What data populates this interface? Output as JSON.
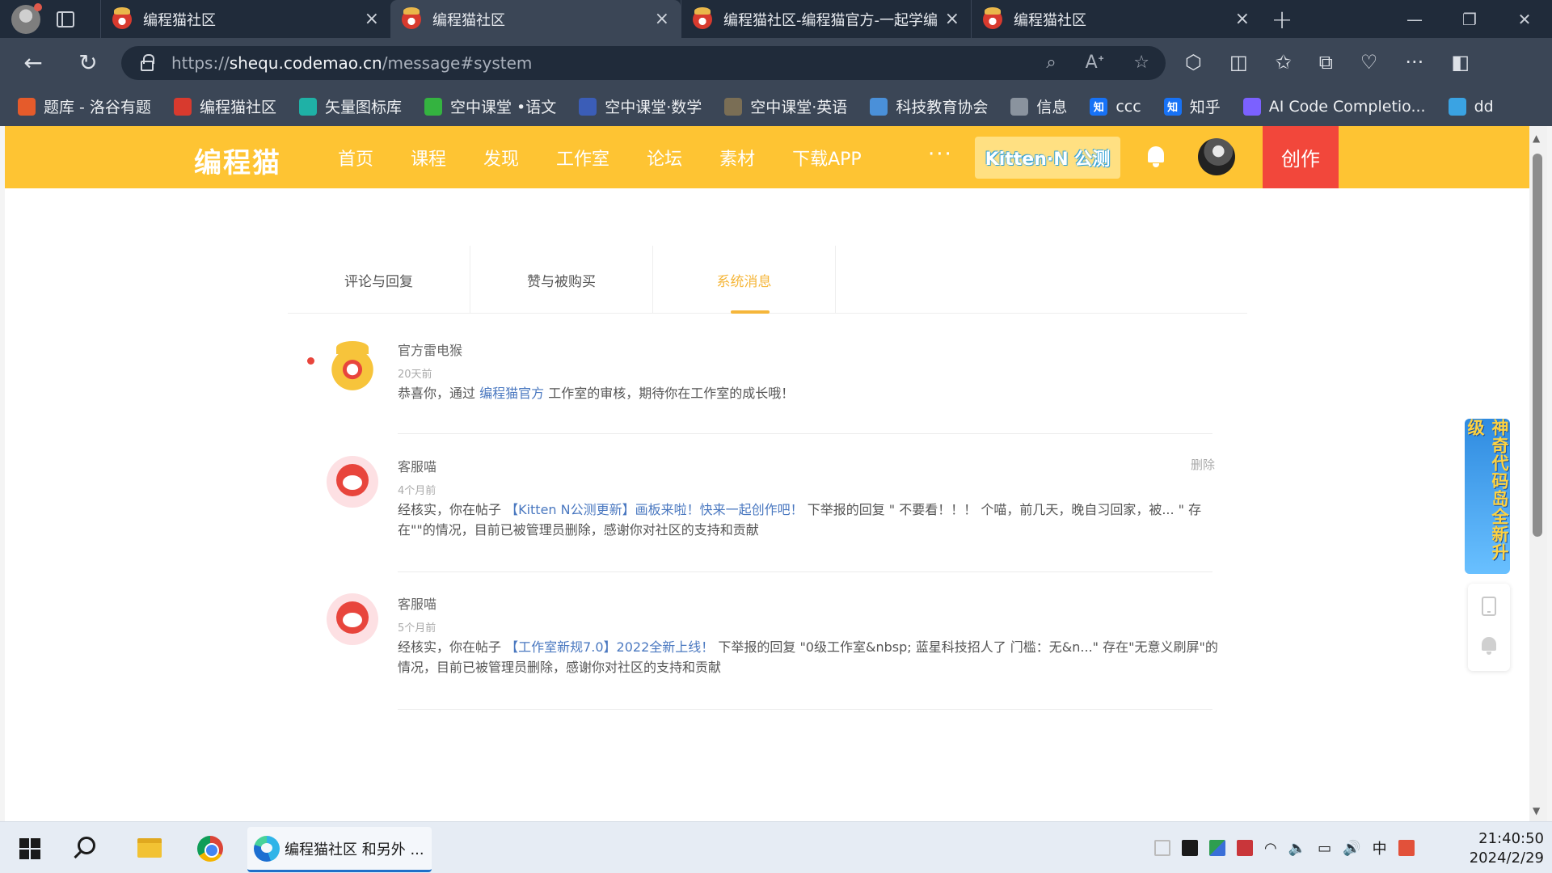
{
  "browser": {
    "tabs": [
      {
        "title": "编程猫社区",
        "active": false
      },
      {
        "title": "编程猫社区",
        "active": true
      },
      {
        "title": "编程猫社区-编程猫官方-一起学编",
        "active": false
      },
      {
        "title": "编程猫社区",
        "active": false
      }
    ],
    "url_prefix": "https://",
    "url_host": "shequ.codemao.cn",
    "url_path": "/message#system",
    "bookmarks": [
      {
        "label": "题库 - 洛谷有题",
        "color": "#e55b2b"
      },
      {
        "label": "编程猫社区",
        "color": "#d83a2e"
      },
      {
        "label": "矢量图标库",
        "color": "#1fb1a6"
      },
      {
        "label": "空中课堂 •语文",
        "color": "#34b340"
      },
      {
        "label": "空中课堂·数学",
        "color": "#3b5db7"
      },
      {
        "label": "空中课堂·英语",
        "color": "#7a6e55"
      },
      {
        "label": "科技教育协会",
        "color": "#4a90d9"
      },
      {
        "label": "信息",
        "color": "#8a939e"
      },
      {
        "label": "ccc",
        "color": "#1772f6",
        "glyph": "知"
      },
      {
        "label": "知乎",
        "color": "#1772f6",
        "glyph": "知"
      },
      {
        "label": "AI Code Completio...",
        "color": "#7b61ff"
      },
      {
        "label": "dd",
        "color": "#3aa3e3"
      }
    ]
  },
  "site": {
    "logo": "编程猫",
    "nav": [
      "首页",
      "课程",
      "发现",
      "工作室",
      "论坛",
      "素材",
      "下载APP"
    ],
    "more": "···",
    "kitten_badge": "Kitten·N 公测",
    "create_label": "创作",
    "brand_color": "#fec433",
    "accent_color": "#f5b63a"
  },
  "messages_page": {
    "tabs": [
      {
        "label": "评论与回复",
        "active": false
      },
      {
        "label": "赞与被购买",
        "active": false
      },
      {
        "label": "系统消息",
        "active": true
      }
    ],
    "items": [
      {
        "unread": true,
        "avatar": "tiger-avatar",
        "name": "官方雷电猴",
        "time": "20天前",
        "body_before": "恭喜你，通过 ",
        "body_link": "编程猫官方",
        "body_after": " 工作室的审核，期待你在工作室的成长哦！",
        "delete_label": ""
      },
      {
        "unread": false,
        "avatar": "cat-avatar",
        "name": "客服喵",
        "time": "4个月前",
        "body_before": "经核实，你在帖子 ",
        "body_link": "【Kitten N公测更新】画板来啦！快来一起创作吧！",
        "body_after": " 下举报的回复 \" 不要看！！！ 个喵，前几天，晚自习回家，被... \" 存在\"\"的情况，目前已被管理员删除，感谢你对社区的支持和贡献",
        "delete_label": "删除"
      },
      {
        "unread": false,
        "avatar": "cat-avatar",
        "name": "客服喵",
        "time": "5个月前",
        "body_before": "经核实，你在帖子 ",
        "body_link": "【工作室新规7.0】2022全新上线！",
        "body_after": " 下举报的回复 \"0级工作室&nbsp; 蓝星科技招人了 门槛：无&n...\" 存在\"无意义刷屏\"的情况，目前已被管理员删除，感谢你对社区的支持和贡献",
        "delete_label": ""
      }
    ]
  },
  "side_widgets": {
    "promo": "神奇代码岛全新升级"
  },
  "taskbar": {
    "edge_label": "编程猫社区 和另外 ...",
    "ime": "中",
    "time": "21:40:50",
    "date": "2024/2/29"
  }
}
